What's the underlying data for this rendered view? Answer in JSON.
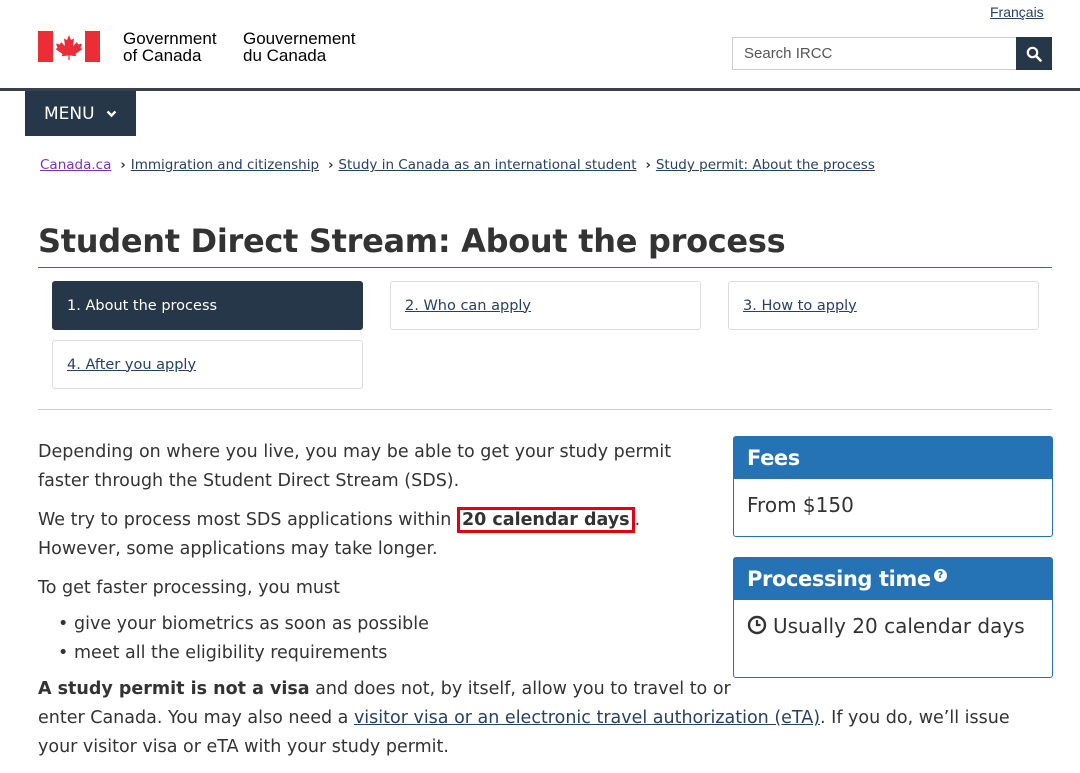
{
  "header": {
    "language_link": "Français",
    "signature_en_line1": "Government",
    "signature_en_line2": "of Canada",
    "signature_fr_line1": "Gouvernement",
    "signature_fr_line2": "du Canada",
    "search_placeholder": "Search IRCC",
    "menu_label": "MENU"
  },
  "breadcrumb": [
    "Canada.ca",
    "Immigration and citizenship",
    "Study in Canada as an international student",
    "Study permit: About the process"
  ],
  "page_title": "Student Direct Stream: About the process",
  "steps": [
    {
      "label": "1. About the process",
      "active": true
    },
    {
      "label": "2. Who can apply",
      "active": false
    },
    {
      "label": "3. How to apply",
      "active": false
    },
    {
      "label": "4. After you apply",
      "active": false
    }
  ],
  "content": {
    "p1": "Depending on where you live, you may be able to get your study permit faster through the Student Direct Stream (SDS).",
    "p2_before": "We try to process most SDS applications within ",
    "p2_highlight": "20 calendar days",
    "p2_after": ". However, some applications may take longer.",
    "p3": "To get faster processing, you must",
    "bullets": [
      "give your biometrics as soon as possible",
      "meet all the eligibility requirements"
    ],
    "p4_bold": "A study permit is not a visa",
    "p4_text1": " and does not, by itself, allow you to travel to or",
    "p4_text2": "enter Canada. You may also need a ",
    "p4_link": "visitor visa or an electronic travel authorization (eTA)",
    "p4_text3": ". If you do, we’ll issue your visitor visa or eTA with your study permit."
  },
  "fees_panel": {
    "title": "Fees",
    "value": "From $150"
  },
  "processing_panel": {
    "title": "Processing time",
    "value": "Usually 20 calendar days"
  },
  "colors": {
    "navy": "#26374a",
    "panel_blue": "#2572b4",
    "title_rule": "#af3c43",
    "highlight_border": "#e3000f",
    "flag_red": "#eb2d37"
  }
}
